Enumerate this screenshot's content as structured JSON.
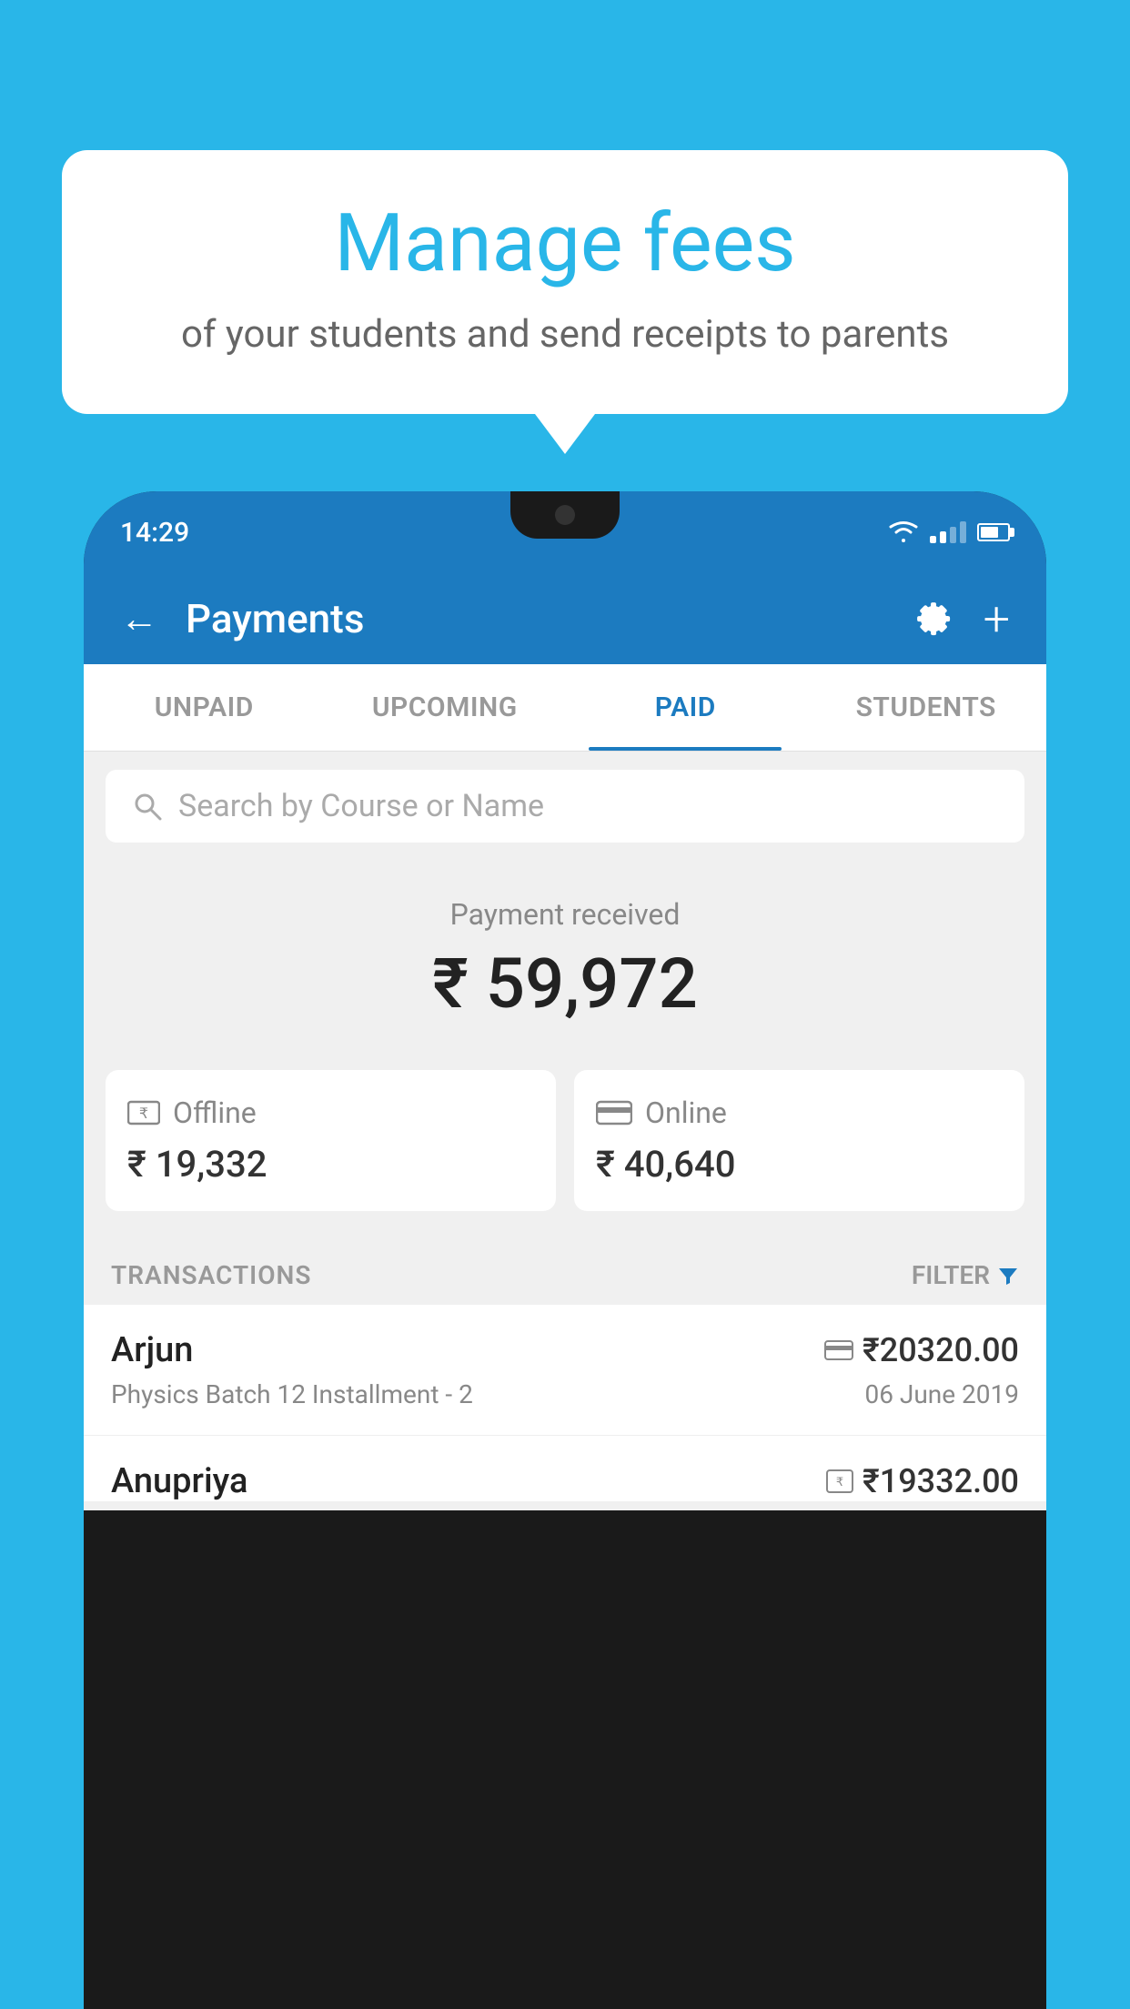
{
  "background_color": "#29b6e8",
  "speech_bubble": {
    "title": "Manage fees",
    "subtitle": "of your students and send receipts to parents"
  },
  "status_bar": {
    "time": "14:29"
  },
  "app_header": {
    "title": "Payments",
    "back_label": "←",
    "plus_label": "+"
  },
  "tabs": [
    {
      "label": "UNPAID",
      "active": false
    },
    {
      "label": "UPCOMING",
      "active": false
    },
    {
      "label": "PAID",
      "active": true
    },
    {
      "label": "STUDENTS",
      "active": false
    }
  ],
  "search": {
    "placeholder": "Search by Course or Name"
  },
  "payment_received": {
    "label": "Payment received",
    "amount": "₹ 59,972"
  },
  "payment_cards": [
    {
      "type": "Offline",
      "amount": "₹ 19,332",
      "icon": "offline"
    },
    {
      "type": "Online",
      "amount": "₹ 40,640",
      "icon": "online"
    }
  ],
  "transactions_section": {
    "label": "TRANSACTIONS",
    "filter_label": "FILTER"
  },
  "transactions": [
    {
      "name": "Arjun",
      "amount": "₹20320.00",
      "payment_type": "online",
      "course": "Physics Batch 12 Installment - 2",
      "date": "06 June 2019"
    },
    {
      "name": "Anupriya",
      "amount": "₹19332.00",
      "payment_type": "offline",
      "course": "",
      "date": ""
    }
  ]
}
